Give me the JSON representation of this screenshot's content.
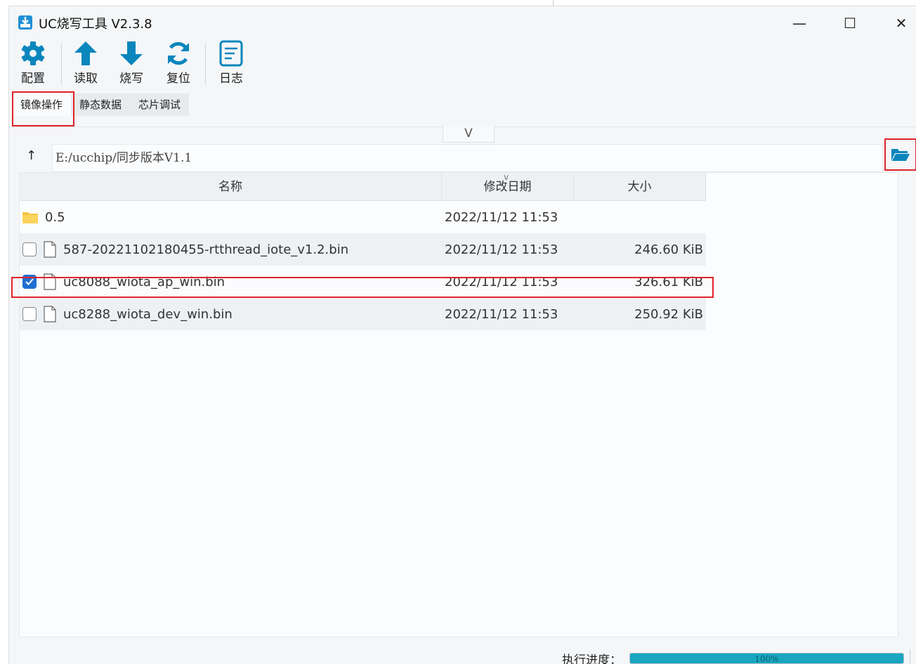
{
  "window": {
    "title": "UC烧写工具 V2.3.8",
    "controls": {
      "minimize": "—",
      "maximize": "☐",
      "close": "✕"
    }
  },
  "toolbar": {
    "items": [
      {
        "label": "配置",
        "icon": "gear-icon"
      },
      {
        "label": "读取",
        "icon": "arrow-up-icon"
      },
      {
        "label": "烧写",
        "icon": "arrow-down-icon"
      },
      {
        "label": "复位",
        "icon": "refresh-icon"
      },
      {
        "label": "日志",
        "icon": "log-icon"
      }
    ]
  },
  "tabs": [
    {
      "label": "镜像操作",
      "active": true
    },
    {
      "label": "静态数据",
      "active": false
    },
    {
      "label": "芯片调试",
      "active": false
    }
  ],
  "collapse_toggle": "V",
  "path_bar": {
    "up_icon": "↑",
    "path": "E:/ucchip/同步版本V1.1"
  },
  "file_table": {
    "columns": {
      "name": "名称",
      "date": "修改日期",
      "size": "大小"
    },
    "sort_indicator": "v",
    "rows": [
      {
        "type": "folder",
        "name": "0.5",
        "date": "2022/11/12 11:53",
        "size": "",
        "checked": null
      },
      {
        "type": "file",
        "name": "587-20221102180455-rtthread_iote_v1.2.bin",
        "date": "2022/11/12 11:53",
        "size": "246.60 KiB",
        "checked": false
      },
      {
        "type": "file",
        "name": "uc8088_wiota_ap_win.bin",
        "date": "2022/11/12 11:53",
        "size": "326.61 KiB",
        "checked": true
      },
      {
        "type": "file",
        "name": "uc8288_wiota_dev_win.bin",
        "date": "2022/11/12 11:53",
        "size": "250.92 KiB",
        "checked": false
      }
    ]
  },
  "status": {
    "label": "执行进度：",
    "progress_percent": 100,
    "progress_text": "100%"
  },
  "colors": {
    "accent": "#1f6fd1",
    "toolbar_icon": "#0a86bd",
    "progress_fill": "#18a6c0",
    "highlight": "#e0242a",
    "folder": "#f5c542"
  }
}
